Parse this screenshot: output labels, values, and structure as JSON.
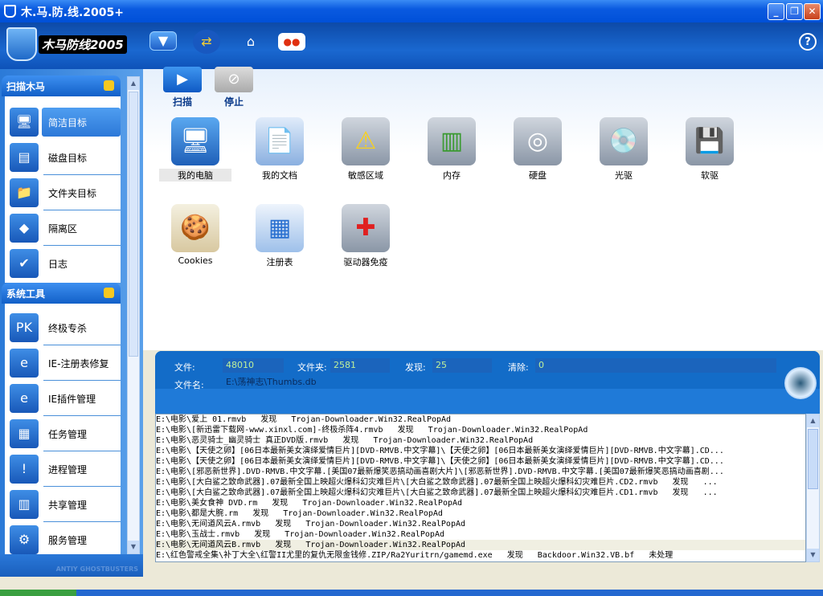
{
  "window": {
    "title": "木.马.防.线.2005+",
    "logo_text": "木马防线2005"
  },
  "toolbar": {
    "items": [
      {
        "icon": "dropdown-icon"
      },
      {
        "icon": "update-icon"
      },
      {
        "icon": "home-icon"
      },
      {
        "icon": "register-card-icon"
      }
    ],
    "help": "?"
  },
  "actions": {
    "scan": "扫描",
    "stop": "停止"
  },
  "sidebar": {
    "scan_header": "扫描木马",
    "scan_items": [
      {
        "label": "简洁目标",
        "icon": "computer-icon",
        "selected": true
      },
      {
        "label": "磁盘目标",
        "icon": "disk-icon"
      },
      {
        "label": "文件夹目标",
        "icon": "folder-search-icon"
      },
      {
        "label": "隔离区",
        "icon": "quarantine-icon"
      },
      {
        "label": "日志",
        "icon": "log-icon"
      }
    ],
    "tools_header": "系统工具",
    "tool_items": [
      {
        "label": "终极专杀",
        "icon": "pk-icon"
      },
      {
        "label": "IE-注册表修复",
        "icon": "ie-repair-icon"
      },
      {
        "label": "IE插件管理",
        "icon": "ie-plugin-icon"
      },
      {
        "label": "任务管理",
        "icon": "task-icon"
      },
      {
        "label": "进程管理",
        "icon": "process-icon"
      },
      {
        "label": "共享管理",
        "icon": "share-icon"
      },
      {
        "label": "服务管理",
        "icon": "service-icon"
      }
    ],
    "footer": "ANTIY GHOSTBUSTERS"
  },
  "targets": [
    {
      "label": "我的电脑",
      "icon": "my-computer-icon"
    },
    {
      "label": "我的文档",
      "icon": "my-documents-icon"
    },
    {
      "label": "敏感区域",
      "icon": "warning-icon"
    },
    {
      "label": "内存",
      "icon": "memory-icon"
    },
    {
      "label": "硬盘",
      "icon": "hard-disk-icon"
    },
    {
      "label": "光驱",
      "icon": "dvd-icon"
    },
    {
      "label": "软驱",
      "icon": "floppy-icon"
    },
    {
      "label": "Cookies",
      "icon": "cookies-icon"
    },
    {
      "label": "注册表",
      "icon": "registry-icon"
    },
    {
      "label": "驱动器免疫",
      "icon": "drive-immune-icon"
    }
  ],
  "status": {
    "files_label": "文件:",
    "files": "48010",
    "folders_label": "文件夹:",
    "folders": "2581",
    "found_label": "发现:",
    "found": "25",
    "cleared_label": "清除:",
    "cleared": "0",
    "filename_label": "文件名:",
    "filename": "E:\\荡神志\\Thumbs.db"
  },
  "log": [
    "E:\\电影\\爱上 01.rmvb   发现   Trojan-Downloader.Win32.RealPopAd",
    "E:\\电影\\[新迅雷下载网-www.xinxl.com]-终极杀阵4.rmvb   发现   Trojan-Downloader.Win32.RealPopAd",
    "E:\\电影\\恶灵骑士_幽灵骑士 真正DVD版.rmvb   发现   Trojan-Downloader.Win32.RealPopAd",
    "E:\\电影\\【天使之卵】[06日本最新美女演绎爱情巨片][DVD-RMVB.中文字幕]\\【天使之卵】[06日本最新美女演绎爱情巨片][DVD-RMVB.中文字幕].CD...",
    "E:\\电影\\【天使之卵】[06日本最新美女演绎爱情巨片][DVD-RMVB.中文字幕]\\【天使之卵】[06日本最新美女演绎爱情巨片][DVD-RMVB.中文字幕].CD...",
    "E:\\电影\\[邪恶新世界].DVD-RMVB.中文字幕.[美国07最新爆笑恶搞动画喜剧大片]\\[邪恶新世界].DVD-RMVB.中文字幕.[美国07最新爆笑恶搞动画喜剧...",
    "E:\\电影\\[大白鲨之致命武器].07最新全国上映超火爆科幻灾难巨片\\[大白鲨之致命武器].07最新全国上映超火爆科幻灾难巨片.CD2.rmvb   发现   ...",
    "E:\\电影\\[大白鲨之致命武器].07最新全国上映超火爆科幻灾难巨片\\[大白鲨之致命武器].07最新全国上映超火爆科幻灾难巨片.CD1.rmvb   发现   ...",
    "E:\\电影\\美女食神 DVD.rm   发现   Trojan-Downloader.Win32.RealPopAd",
    "E:\\电影\\都是大腕.rm   发现   Trojan-Downloader.Win32.RealPopAd",
    "E:\\电影\\无间道风云A.rmvb   发现   Trojan-Downloader.Win32.RealPopAd",
    "E:\\电影\\玉战士.rmvb   发现   Trojan-Downloader.Win32.RealPopAd",
    "E:\\电影\\无间道风云B.rmvb   发现   Trojan-Downloader.Win32.RealPopAd",
    "E:\\红色警戒全集\\补丁大全\\红警II尤里的复仇无限金钱修.ZIP/Ra2Yuritrn/gamemd.exe   发现   Backdoor.Win32.VB.bf   未处理"
  ],
  "colors": {
    "accent": "#1f7ad8",
    "title": "#0050d8"
  }
}
